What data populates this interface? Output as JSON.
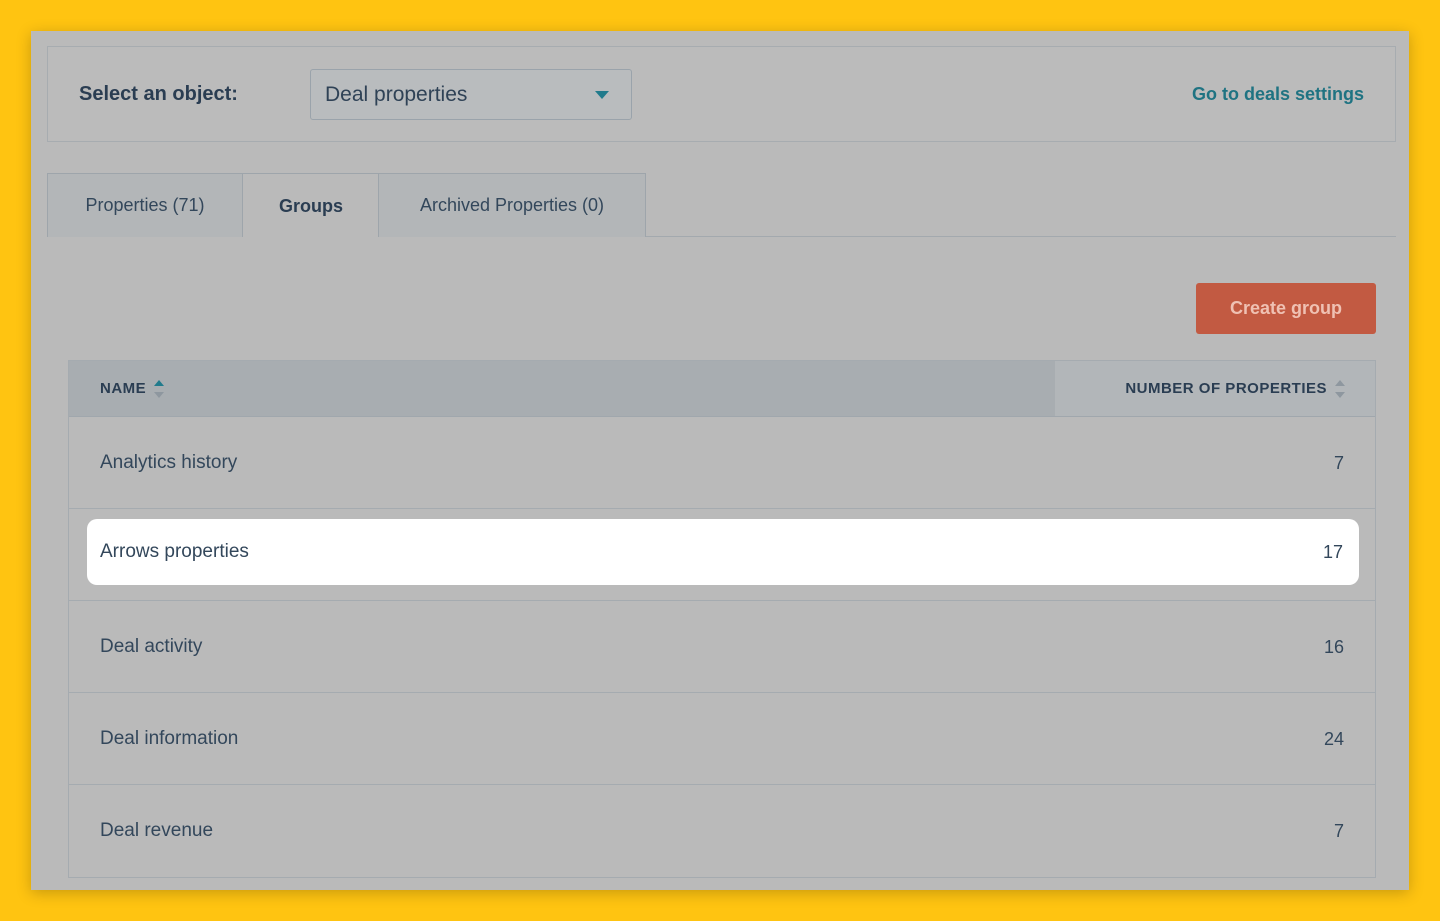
{
  "header": {
    "object_label": "Select an object:",
    "object_select_value": "Deal properties",
    "deals_link": "Go to deals settings"
  },
  "tabs": [
    {
      "label": "Properties (71)",
      "active": false
    },
    {
      "label": "Groups",
      "active": true
    },
    {
      "label": "Archived Properties (0)",
      "active": false
    }
  ],
  "actions": {
    "create_group": "Create group"
  },
  "table": {
    "columns": [
      "NAME",
      "NUMBER OF PROPERTIES"
    ],
    "sorted_by": "NAME",
    "rows": [
      {
        "name": "Analytics history",
        "count": "7"
      },
      {
        "name": "Arrows properties",
        "count": "17",
        "highlighted": true
      },
      {
        "name": "Deal activity",
        "count": "16"
      },
      {
        "name": "Deal information",
        "count": "24"
      },
      {
        "name": "Deal revenue",
        "count": "7"
      }
    ]
  },
  "colors": {
    "background": "#FFC411",
    "accent_teal": "#217b8c",
    "create_button": "#c25a42",
    "highlight_row": "#ffffff"
  }
}
